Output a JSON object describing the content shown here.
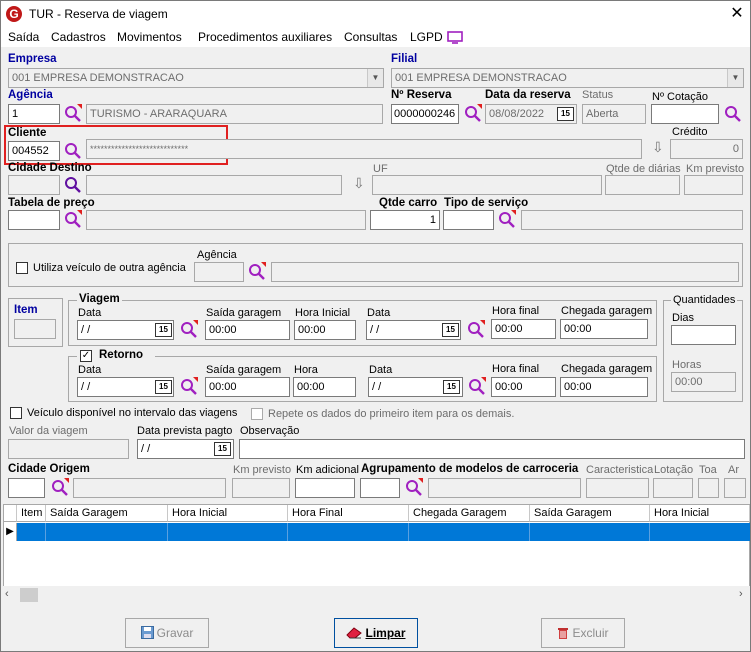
{
  "window": {
    "title": "TUR - Reserva de viagem",
    "close": "✕",
    "app_icon_letter": "G"
  },
  "menu": [
    "Saída",
    "Cadastros",
    "Movimentos",
    "Procedimentos auxiliares",
    "Consultas",
    "LGPD"
  ],
  "empresa": {
    "label": "Empresa",
    "value": "001 EMPRESA DEMONSTRACAO"
  },
  "filial": {
    "label": "Filial",
    "value": "001 EMPRESA DEMONSTRACAO"
  },
  "agencia": {
    "label": "Agência",
    "code": "1",
    "name": "TURISMO - ARARAQUARA"
  },
  "reserva": {
    "label": "Nº Reserva",
    "value": "0000000246"
  },
  "data_reserva": {
    "label": "Data da reserva",
    "value": "08/08/2022",
    "cal": "15"
  },
  "status": {
    "label": "Status",
    "value": "Aberta"
  },
  "cotacao": {
    "label": "Nº Cotação",
    "value": ""
  },
  "cliente": {
    "label": "Cliente",
    "code": "004552",
    "name": "****************************"
  },
  "credito": {
    "label": "Crédito",
    "value": "0"
  },
  "cidade_destino": {
    "label": "Cidade Destino",
    "value": ""
  },
  "uf": {
    "label": "UF",
    "value": ""
  },
  "qtde_diarias": {
    "label": "Qtde de diárias",
    "value": ""
  },
  "km_previsto": {
    "label": "Km previsto",
    "value": ""
  },
  "tabela_preco": {
    "label": "Tabela de preço",
    "value": ""
  },
  "qtde_carro": {
    "label": "Qtde carro",
    "value": "1"
  },
  "tipo_servico": {
    "label": "Tipo de serviço",
    "value": ""
  },
  "outra_agencia": {
    "label": "Utiliza veículo de outra agência",
    "agencia_label": "Agência"
  },
  "item": {
    "label": "Item",
    "value": ""
  },
  "viagem": {
    "title": "Viagem",
    "data_label": "Data",
    "data": " / /",
    "saida_label": "Saída garagem",
    "saida": "00:00",
    "hora_inicial_label": "Hora Inicial",
    "hora_inicial": "00:00",
    "data2_label": "Data",
    "data2": " / /",
    "hora_final_label": "Hora final",
    "hora_final": "00:00",
    "chegada_label": "Chegada garagem",
    "chegada": "00:00"
  },
  "retorno": {
    "title": "Retorno",
    "checked": "✓",
    "data_label": "Data",
    "data": " / /",
    "saida_label": "Saída garagem",
    "saida": "00:00",
    "hora_label": "Hora",
    "hora": "00:00",
    "data2_label": "Data",
    "data2": " / /",
    "hora_final_label": "Hora final",
    "hora_final": "00:00",
    "chegada_label": "Chegada garagem",
    "chegada": "00:00"
  },
  "quantidades": {
    "title": "Quantidades",
    "dias_label": "Dias",
    "dias": "",
    "horas_label": "Horas",
    "horas": "00:00"
  },
  "veiculo_disponivel": {
    "label": "Veículo disponível no intervalo das viagens"
  },
  "repete_dados": {
    "label": "Repete os dados do primeiro item para os demais."
  },
  "valor_viagem": {
    "label": "Valor da viagem",
    "value": ""
  },
  "data_prevista": {
    "label": "Data prevista pagto",
    "value": " / /"
  },
  "observacao": {
    "label": "Observação",
    "value": ""
  },
  "origem": {
    "cidade_label": "Cidade Origem",
    "km_previsto_label": "Km previsto",
    "km_adicional_label": "Km adicional",
    "agrupamento_label": "Agrupamento de modelos de carroceria",
    "caracteristica_label": "Caracteristica",
    "lotacao_label": "Lotação",
    "toa_label": "Toa",
    "ar_label": "Ar"
  },
  "grid": {
    "columns": [
      "Item",
      "Saída Garagem",
      "Hora Inicial",
      "Hora Final",
      "Chegada Garagem",
      "Saída Garagem",
      "Hora Inicial"
    ],
    "row_marker": "▶"
  },
  "buttons": {
    "gravar": "Gravar",
    "limpar": "Limpar",
    "excluir": "Excluir"
  },
  "colors": {
    "accent": "#0078d7",
    "highlight_box": "#e02020",
    "magnifier": "#a020c0"
  }
}
